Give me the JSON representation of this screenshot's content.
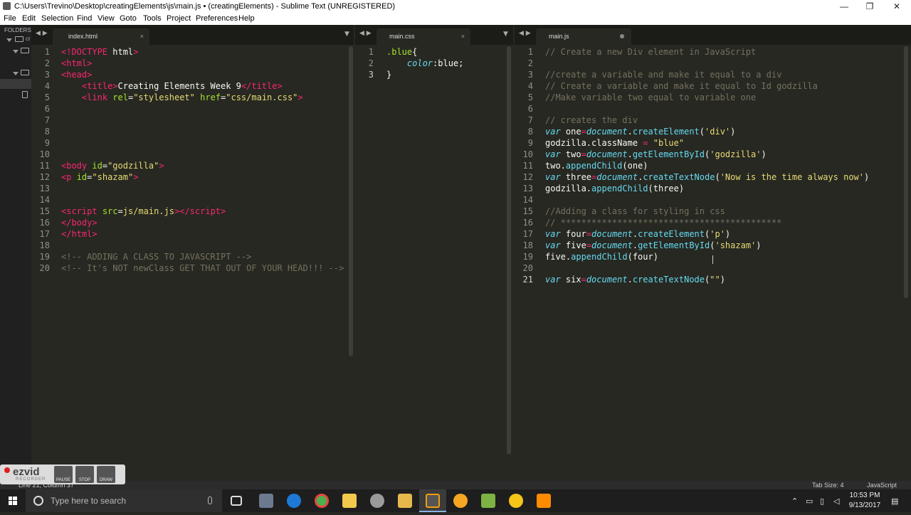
{
  "window": {
    "title": "C:\\Users\\Trevino\\Desktop\\creatingElements\\js\\main.js • (creatingElements) - Sublime Text (UNREGISTERED)",
    "controls": {
      "minimize": "—",
      "maximize": "❐",
      "close": "✕"
    }
  },
  "menu": [
    "File",
    "Edit",
    "Selection",
    "Find",
    "View",
    "Goto",
    "Tools",
    "Project",
    "Preferences",
    "Help"
  ],
  "sidebar": {
    "label": "FOLDERS",
    "items": [
      "cr",
      "",
      "",
      ""
    ]
  },
  "panes": [
    {
      "tab": "index.html",
      "close": "×",
      "lines": [
        [
          [
            "tag",
            "<!"
          ],
          [
            "tag",
            "DOCTYPE"
          ],
          [
            "val",
            " html"
          ],
          [
            "tag",
            ">"
          ]
        ],
        [
          [
            "tag",
            "<"
          ],
          [
            "tag",
            "html"
          ],
          [
            "tag",
            ">"
          ]
        ],
        [
          [
            "tag",
            "<"
          ],
          [
            "tag",
            "head"
          ],
          [
            "tag",
            ">"
          ]
        ],
        [
          [
            "val",
            "    "
          ],
          [
            "tag",
            "<"
          ],
          [
            "tag",
            "title"
          ],
          [
            "tag",
            ">"
          ],
          [
            "val",
            "Creating Elements Week 9"
          ],
          [
            "tag",
            "</"
          ],
          [
            "tag",
            "title"
          ],
          [
            "tag",
            ">"
          ]
        ],
        [
          [
            "val",
            "    "
          ],
          [
            "tag",
            "<"
          ],
          [
            "tag",
            "link"
          ],
          [
            "attr",
            " rel"
          ],
          [
            "val",
            "="
          ],
          [
            "str",
            "\"stylesheet\""
          ],
          [
            "attr",
            " href"
          ],
          [
            "val",
            "="
          ],
          [
            "str",
            "\"css/main.css\""
          ],
          [
            "tag",
            ">"
          ]
        ],
        [],
        [],
        [],
        [],
        [],
        [
          [
            "tag",
            "<"
          ],
          [
            "tag",
            "body"
          ],
          [
            "attr",
            " id"
          ],
          [
            "val",
            "="
          ],
          [
            "str",
            "\"godzilla\""
          ],
          [
            "tag",
            ">"
          ]
        ],
        [
          [
            "tag",
            "<"
          ],
          [
            "tag",
            "p"
          ],
          [
            "attr",
            " id"
          ],
          [
            "val",
            "="
          ],
          [
            "str",
            "\"shazam\""
          ],
          [
            "tag",
            ">"
          ]
        ],
        [],
        [],
        [
          [
            "tag",
            "<"
          ],
          [
            "tag",
            "script"
          ],
          [
            "attr",
            " src"
          ],
          [
            "val",
            "="
          ],
          [
            "str",
            "js/main.js"
          ],
          [
            "tag",
            ">"
          ],
          [
            "tag",
            "</"
          ],
          [
            "tag",
            "script"
          ],
          [
            "tag",
            ">"
          ]
        ],
        [
          [
            "tag",
            "</"
          ],
          [
            "tag",
            "body"
          ],
          [
            "tag",
            ">"
          ]
        ],
        [
          [
            "tag",
            "</"
          ],
          [
            "tag",
            "html"
          ],
          [
            "tag",
            ">"
          ]
        ],
        [],
        [
          [
            "cm",
            "<!-- ADDING A CLASS TO JAVASCRIPT -->"
          ]
        ],
        [
          [
            "cm",
            "<!-- It's NOT newClass GET THAT OUT OF YOUR HEAD!!! -->"
          ]
        ]
      ]
    },
    {
      "tab": "main.css",
      "close": "×",
      "active_line": 3,
      "lines": [
        [
          [
            "cls",
            ".blue"
          ],
          [
            "val",
            "{"
          ]
        ],
        [
          [
            "val",
            "    "
          ],
          [
            "prop",
            "color"
          ],
          [
            "val",
            ":blue;"
          ]
        ],
        [
          [
            "val",
            "}"
          ]
        ]
      ]
    },
    {
      "tab": "main.js",
      "dirty": true,
      "active_line": 21,
      "lines": [
        [
          [
            "cm",
            "// Create a new Div element in JavaScript"
          ]
        ],
        [],
        [
          [
            "cm",
            "//create a variable and make it equal to a div"
          ]
        ],
        [
          [
            "cm",
            "// Create a variable and make it equal to Id godzilla"
          ]
        ],
        [
          [
            "cm",
            "//Make variable two equal to variable one"
          ]
        ],
        [],
        [
          [
            "cm",
            "// creates the div"
          ]
        ],
        [
          [
            "kw",
            "var"
          ],
          [
            "val",
            " one"
          ],
          [
            "op",
            "="
          ],
          [
            "obj",
            "document"
          ],
          [
            "val",
            "."
          ],
          [
            "fn",
            "createElement"
          ],
          [
            "val",
            "("
          ],
          [
            "str",
            "'div'"
          ],
          [
            "val",
            ")"
          ]
        ],
        [
          [
            "val",
            "godzilla.className "
          ],
          [
            "op",
            "="
          ],
          [
            "val",
            " "
          ],
          [
            "str",
            "\"blue\""
          ]
        ],
        [
          [
            "kw",
            "var"
          ],
          [
            "val",
            " two"
          ],
          [
            "op",
            "="
          ],
          [
            "obj",
            "document"
          ],
          [
            "val",
            "."
          ],
          [
            "fn",
            "getElementById"
          ],
          [
            "val",
            "("
          ],
          [
            "str",
            "'godzilla'"
          ],
          [
            "val",
            ")"
          ]
        ],
        [
          [
            "val",
            "two."
          ],
          [
            "fn",
            "appendChild"
          ],
          [
            "val",
            "(one)"
          ]
        ],
        [
          [
            "kw",
            "var"
          ],
          [
            "val",
            " three"
          ],
          [
            "op",
            "="
          ],
          [
            "obj",
            "document"
          ],
          [
            "val",
            "."
          ],
          [
            "fn",
            "createTextNode"
          ],
          [
            "val",
            "("
          ],
          [
            "str",
            "'Now is the time always now'"
          ],
          [
            "val",
            ")"
          ]
        ],
        [
          [
            "val",
            "godzilla."
          ],
          [
            "fn",
            "appendChild"
          ],
          [
            "val",
            "(three)"
          ]
        ],
        [],
        [
          [
            "cm",
            "//Adding a class for styling in css"
          ]
        ],
        [
          [
            "cm",
            "// *******************************************"
          ]
        ],
        [
          [
            "kw",
            "var"
          ],
          [
            "val",
            " four"
          ],
          [
            "op",
            "="
          ],
          [
            "obj",
            "document"
          ],
          [
            "val",
            "."
          ],
          [
            "fn",
            "createElement"
          ],
          [
            "val",
            "("
          ],
          [
            "str",
            "'p'"
          ],
          [
            "val",
            ")"
          ]
        ],
        [
          [
            "kw",
            "var"
          ],
          [
            "val",
            " five"
          ],
          [
            "op",
            "="
          ],
          [
            "obj",
            "document"
          ],
          [
            "val",
            "."
          ],
          [
            "fn",
            "getElementById"
          ],
          [
            "val",
            "("
          ],
          [
            "str",
            "'shazam'"
          ],
          [
            "val",
            ")"
          ]
        ],
        [
          [
            "val",
            "five."
          ],
          [
            "fn",
            "appendChild"
          ],
          [
            "val",
            "(four)"
          ]
        ],
        [],
        [
          [
            "kw",
            "var"
          ],
          [
            "val",
            " six"
          ],
          [
            "op",
            "="
          ],
          [
            "obj",
            "document"
          ],
          [
            "val",
            "."
          ],
          [
            "fn",
            "createTextNode"
          ],
          [
            "val",
            "("
          ],
          [
            "str",
            "\"\""
          ],
          [
            "val",
            ")"
          ]
        ]
      ]
    }
  ],
  "status": {
    "left": "Line 21, Column 37",
    "tab_size": "Tab Size: 4",
    "syntax": "JavaScript"
  },
  "ezvid": {
    "logo": "ezvid",
    "sub": "RECORDER",
    "controls": [
      "PAUSE",
      "STOP",
      "DRAW"
    ]
  },
  "taskbar": {
    "search_placeholder": "Type here to search",
    "time": "10:53 PM",
    "date": "9/13/2017"
  }
}
